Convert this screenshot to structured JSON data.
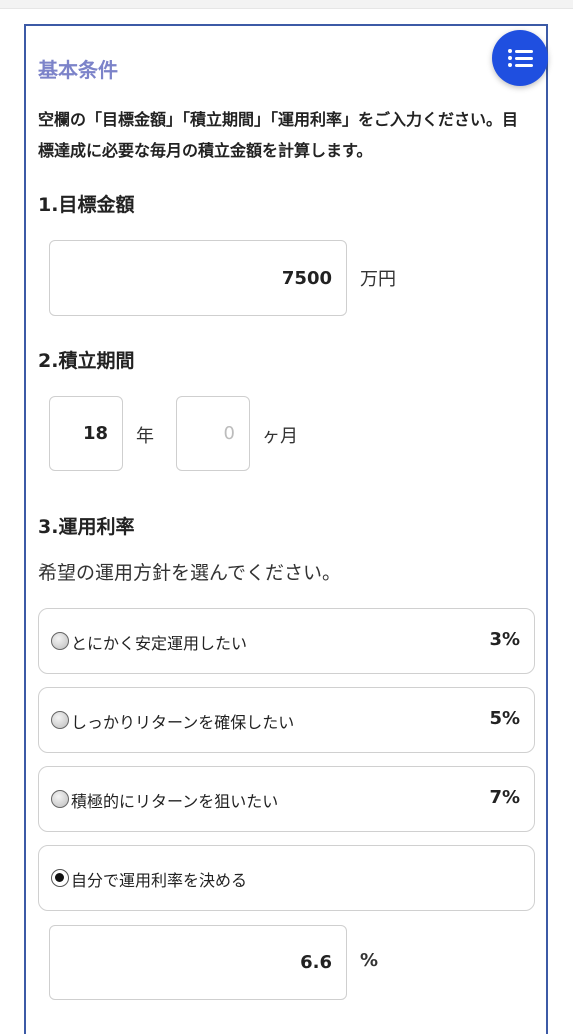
{
  "section": {
    "title": "基本条件"
  },
  "menu": {
    "icon": "list-menu-icon"
  },
  "intro": "空欄の「目標金額」「積立期間」「運用利率」をご入力ください。目標達成に必要な毎月の積立金額を計算します。",
  "target": {
    "title": "1.目標金額",
    "value": "7500",
    "unit": "万円"
  },
  "period": {
    "title": "2.積立期間",
    "years_value": "18",
    "years_unit": "年",
    "months_placeholder": "0",
    "months_unit": "ヶ月"
  },
  "rate": {
    "title": "3.運用利率",
    "hint": "希望の運用方針を選んでください。",
    "options": [
      {
        "label": "とにかく安定運用したい",
        "rate": "3%",
        "selected": false
      },
      {
        "label": "しっかりリターンを確保したい",
        "rate": "5%",
        "selected": false
      },
      {
        "label": "積極的にリターンを狙いたい",
        "rate": "7%",
        "selected": false
      },
      {
        "label": "自分で運用利率を決める",
        "rate": "",
        "selected": true
      }
    ],
    "custom_value": "6.6",
    "custom_unit": "%"
  },
  "colors": {
    "accent": "#1f4fe0",
    "section_title": "#7c83c9",
    "panel_border": "#3c5aa6"
  }
}
